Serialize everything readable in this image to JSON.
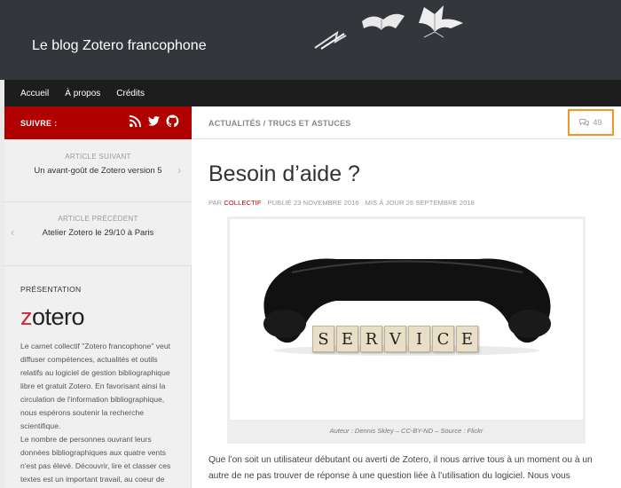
{
  "header": {
    "site_title": "Le blog Zotero francophone"
  },
  "nav": {
    "items": [
      "Accueil",
      "À propos",
      "Crédits"
    ]
  },
  "sidebar": {
    "follow_label": "SUIVRE :",
    "social_icons": [
      "rss-icon",
      "twitter-icon",
      "github-icon"
    ],
    "next_article": {
      "label": "ARTICLE SUIVANT",
      "title": "Un avant-goût de Zotero version 5"
    },
    "prev_article": {
      "label": "ARTICLE PRÉCÉDENT",
      "title": "Atelier Zotero le 29/10 à Paris"
    },
    "presentation": {
      "heading": "PRÉSENTATION",
      "logo_first": "z",
      "logo_rest": "otero",
      "text": "Le carnet collectif \"Zotero francophone\" veut diffuser compétences, actualités et outils relatifs au logiciel de gestion bibliographique libre et gratuit Zotero. En favorisant ainsi la circulation de l'information bibliographique, nous espérons soutenir la recherche scientifique.\nLe nombre de personnes ouvrant leurs données bibliographiques aux quatre vents n'est pas élevé. Découvrir, lire et classer ces textes est un important travail, au coeur de"
    }
  },
  "main": {
    "breadcrumb": "ACTUALITÉS / TRUCS ET ASTUCES",
    "comment_count": "49",
    "title": "Besoin d’aide ?",
    "meta": {
      "by": "PAR",
      "author": "COLLECTIF",
      "published": " · PUBLIÉ 23 NOVEMBRE 2016 · MIS À JOUR 26 SEPTEMBRE 2018"
    },
    "image_text": "SERVICE",
    "caption": "Auteur : Dennis Skley – CC-BY-ND – Source : Flickr",
    "body": "Que l’on soit un utilisateur débutant ou averti de Zotero, il nous arrive tous à un moment ou à un autre de ne pas trouver de réponse à une question liée à l’utilisation du logiciel. Nous vous"
  },
  "colors": {
    "header_bg": "#33363b",
    "nav_bg": "#1d1d1d",
    "follow_bg": "#b10000",
    "highlight": "#f29722",
    "logo_accent": "#cc2936"
  }
}
